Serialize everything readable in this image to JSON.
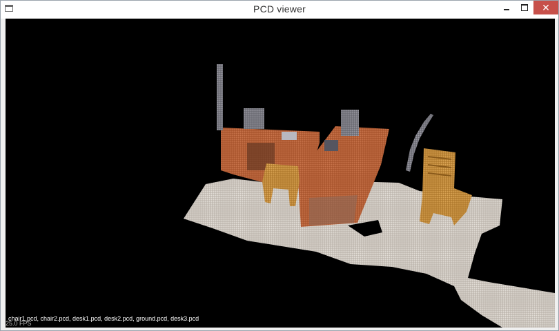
{
  "window": {
    "title": "PCD viewer",
    "minimize_icon": "minimize-icon",
    "maximize_icon": "maximize-icon",
    "close_label": "✕"
  },
  "viewer": {
    "loaded_files": "chair1.pcd, chair2.pcd, desk1.pcd, desk2.pcd, ground.pcd, desk3.pcd",
    "fps_text": "25.0 FPS"
  },
  "colors": {
    "background": "#000000",
    "floor": "#cfc9c2",
    "desk_wood": "#b8643a",
    "chair_wood": "#c9933f",
    "close_button": "#c7504a"
  }
}
